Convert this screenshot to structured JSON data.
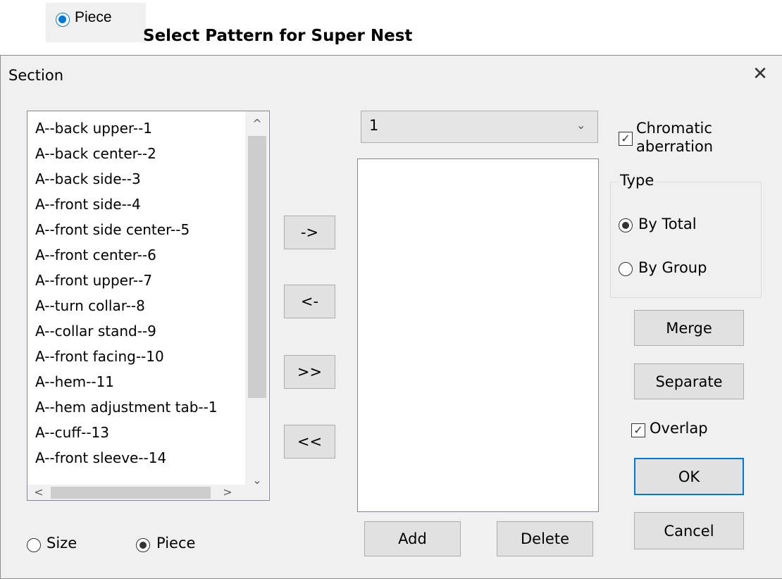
{
  "caption": {
    "radio_label": "Piece",
    "heading": "Select Pattern for Super Nest"
  },
  "dialog": {
    "title": "Section",
    "close_glyph": "✕"
  },
  "piece_list": {
    "items": [
      "A--back upper--1",
      "A--back center--2",
      "A--back side--3",
      "A--front side--4",
      "A--front side center--5",
      "A--front center--6",
      "A--front upper--7",
      "A--turn collar--8",
      "A--collar stand--9",
      "A--front facing--10",
      "A--hem--11",
      "A--hem adjustment tab--1",
      "A--cuff--13",
      "A--front sleeve--14"
    ]
  },
  "mode": {
    "size_label": "Size",
    "piece_label": "Piece",
    "selected": "Piece"
  },
  "transfer": {
    "move_right": "->",
    "move_left": "<-",
    "move_all_right": ">>",
    "move_all_left": "<<"
  },
  "group_select": {
    "value": "1"
  },
  "group_actions": {
    "add_label": "Add",
    "delete_label": "Delete"
  },
  "options": {
    "chromatic_line1": "Chromatic",
    "chromatic_line2": "aberration",
    "chromatic_checked": true,
    "overlap_label": "Overlap",
    "overlap_checked": true
  },
  "type_group": {
    "title": "Type",
    "by_total": "By Total",
    "by_group": "By Group",
    "selected": "By Total"
  },
  "buttons": {
    "merge": "Merge",
    "separate": "Separate",
    "ok": "OK",
    "cancel": "Cancel"
  },
  "icons": {
    "checkmark": "✓",
    "scroll_up": "^",
    "scroll_down": "⌄",
    "scroll_left": "<",
    "scroll_right": ">",
    "dropdown": "⌄"
  }
}
